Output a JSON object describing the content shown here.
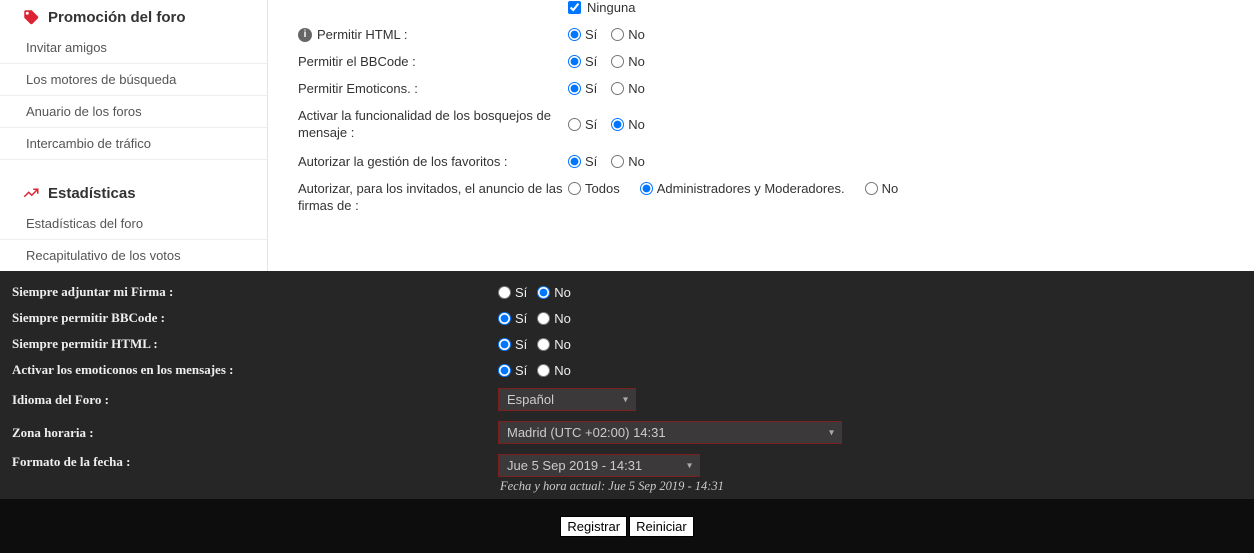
{
  "sidebar": {
    "section1": {
      "title": "Promoción del foro"
    },
    "items1": [
      {
        "label": "Invitar amigos"
      },
      {
        "label": "Los motores de búsqueda"
      },
      {
        "label": "Anuario de los foros"
      },
      {
        "label": "Intercambio de tráfico"
      }
    ],
    "section2": {
      "title": "Estadísticas"
    },
    "items2": [
      {
        "label": "Estadísticas del foro"
      },
      {
        "label": "Recapitulativo de los votos"
      }
    ]
  },
  "light_form": {
    "none_label": "Ninguna",
    "rows": [
      {
        "label": "Permitir HTML :",
        "has_info": true,
        "selected": "si"
      },
      {
        "label": "Permitir el BBCode :",
        "selected": "si"
      },
      {
        "label": "Permitir Emoticons. :",
        "selected": "si"
      },
      {
        "label": "Activar la funcionalidad de los bosquejos de mensaje :",
        "selected": "no"
      },
      {
        "label": "Autorizar la gestión de los favoritos :",
        "selected": "si"
      }
    ],
    "si": "Sí",
    "no": "No",
    "signatures_label": "Autorizar, para los invitados, el anuncio de las firmas de :",
    "sig_opts": {
      "todos": "Todos",
      "admins": "Administradores y Moderadores.",
      "no": "No"
    },
    "sig_selected": "admins"
  },
  "dark_form": {
    "rows_yn": [
      {
        "label": "Siempre adjuntar mi Firma :",
        "selected": "no"
      },
      {
        "label": "Siempre permitir BBCode :",
        "selected": "si"
      },
      {
        "label": "Siempre permitir HTML :",
        "selected": "si"
      },
      {
        "label": "Activar los emoticonos en los mensajes :",
        "selected": "si"
      }
    ],
    "si": "Sí",
    "no": "No",
    "lang_label": "Idioma del Foro :",
    "lang_value": "Español",
    "tz_label": "Zona horaria :",
    "tz_value": "Madrid (UTC +02:00) 14:31",
    "date_label": "Formato de la fecha :",
    "date_value": "Jue 5 Sep 2019 - 14:31",
    "helper": "Fecha y hora actual: Jue 5 Sep 2019 - 14:31"
  },
  "buttons": {
    "save": "Registrar",
    "reset": "Reiniciar"
  }
}
